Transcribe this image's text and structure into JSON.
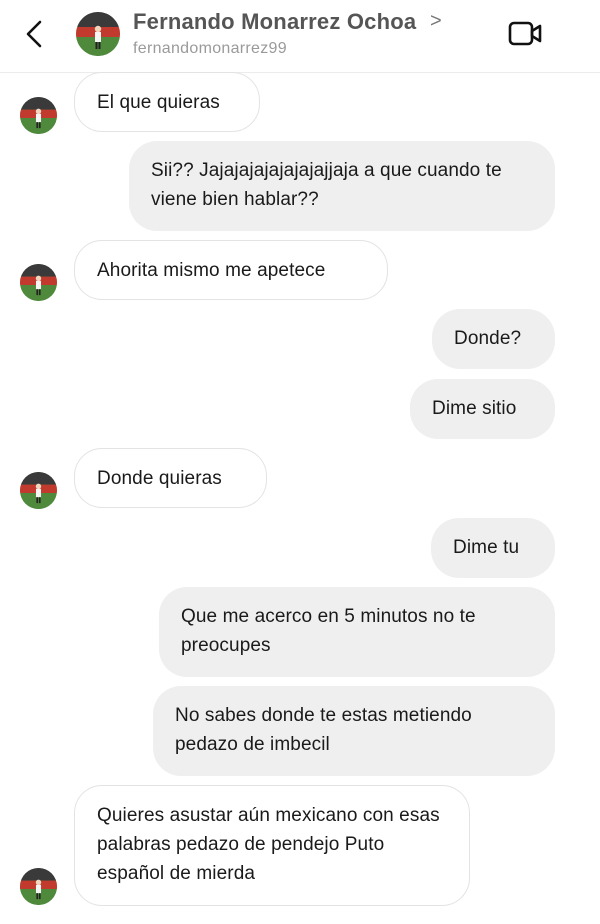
{
  "header": {
    "name": "Fernando Monarrez Ochoa",
    "chevron": ">",
    "username": "fernandomonarrez99",
    "back_icon": "chevron-left-icon",
    "video_icon": "video-camera-icon"
  },
  "messages": [
    {
      "direction": "in",
      "text": "El que quieras",
      "avatar": true
    },
    {
      "direction": "out",
      "text": "Sii?? Jajajajajajajajajjaja a que cuando te viene bien hablar??"
    },
    {
      "direction": "in",
      "text": "Ahorita mismo me apetece",
      "avatar": true
    },
    {
      "direction": "out",
      "text": "Donde?"
    },
    {
      "direction": "out",
      "text": "Dime sitio"
    },
    {
      "direction": "in",
      "text": "Donde quieras",
      "avatar": true
    },
    {
      "direction": "out",
      "text": "Dime tu"
    },
    {
      "direction": "out",
      "text": "Que me acerco en 5 minutos no te preocupes"
    },
    {
      "direction": "out",
      "text": "No sabes donde te estas metiendo pedazo de imbecil"
    },
    {
      "direction": "in",
      "text": "Quieres asustar aún mexicano con esas palabras pedazo de pendejo Puto español de mierda",
      "avatar": true
    }
  ],
  "colors": {
    "incoming_bubble_bg": "#ffffff",
    "incoming_bubble_border": "#e3e3e3",
    "outgoing_bubble_bg": "#efefef",
    "name_text": "#555555",
    "username_text": "#9a9a9a"
  }
}
